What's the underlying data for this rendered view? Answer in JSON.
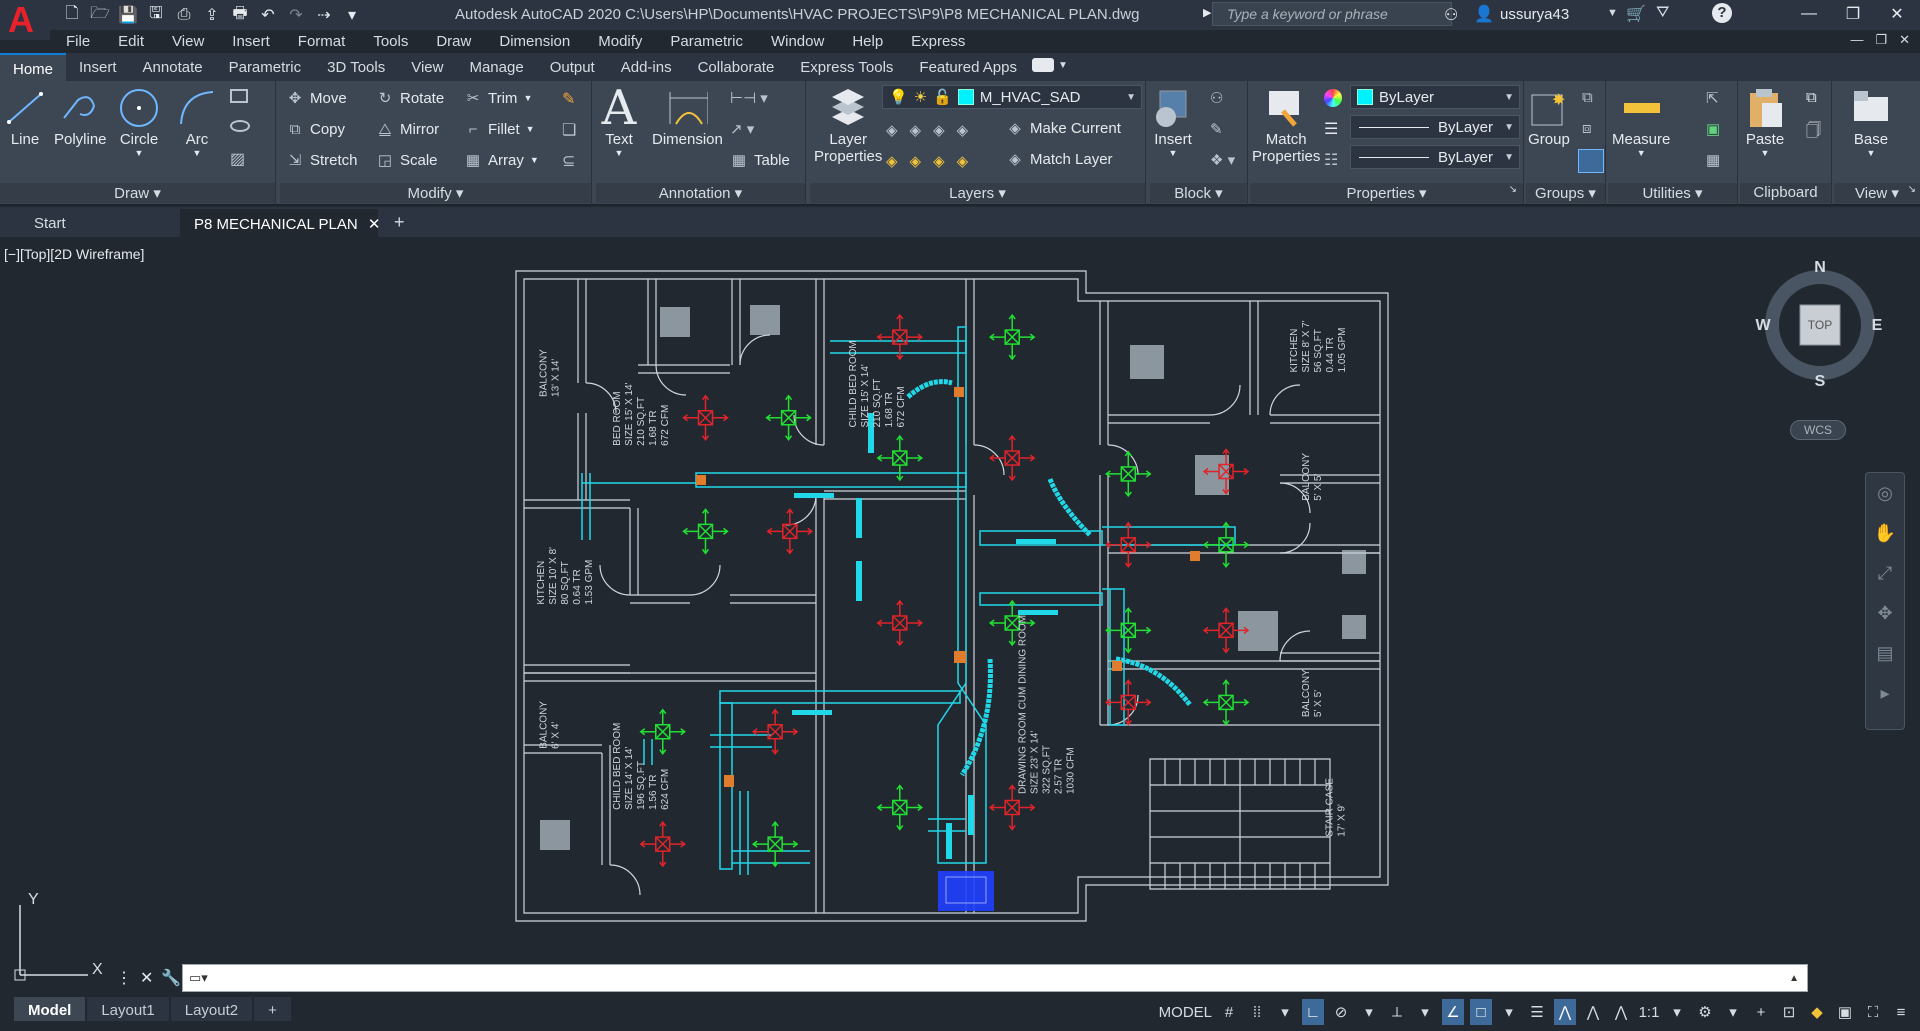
{
  "app": {
    "logo_letter": "A",
    "title": "Autodesk AutoCAD 2020    C:\\Users\\HP\\Documents\\HVAC PROJECTS\\P9\\P8 MECHANICAL PLAN.dwg",
    "search_placeholder": "Type a keyword or phrase",
    "username": "ussurya43"
  },
  "menu": [
    "File",
    "Edit",
    "View",
    "Insert",
    "Format",
    "Tools",
    "Draw",
    "Dimension",
    "Modify",
    "Parametric",
    "Window",
    "Help",
    "Express"
  ],
  "ribbon_tabs": [
    "Home",
    "Insert",
    "Annotate",
    "Parametric",
    "3D Tools",
    "View",
    "Manage",
    "Output",
    "Add-ins",
    "Collaborate",
    "Express Tools",
    "Featured Apps"
  ],
  "ribbon": {
    "draw": {
      "title": "Draw",
      "line": "Line",
      "polyline": "Polyline",
      "circle": "Circle",
      "arc": "Arc"
    },
    "modify": {
      "title": "Modify",
      "move": "Move",
      "rotate": "Rotate",
      "trim": "Trim",
      "copy": "Copy",
      "mirror": "Mirror",
      "fillet": "Fillet",
      "stretch": "Stretch",
      "scale": "Scale",
      "array": "Array"
    },
    "annotation": {
      "title": "Annotation",
      "text": "Text",
      "dimension": "Dimension",
      "table": "Table"
    },
    "layers": {
      "title": "Layers",
      "layer_properties_1": "Layer",
      "layer_properties_2": "Properties",
      "current_layer": "M_HVAC_SAD",
      "make_current": "Make Current",
      "match_layer": "Match Layer"
    },
    "block": {
      "title": "Block",
      "insert": "Insert"
    },
    "properties": {
      "title": "Properties",
      "match_1": "Match",
      "match_2": "Properties",
      "color": "ByLayer",
      "linetype": "ByLayer",
      "lineweight": "ByLayer"
    },
    "groups": {
      "title": "Groups",
      "group": "Group"
    },
    "utilities": {
      "title": "Utilities",
      "measure": "Measure"
    },
    "clipboard": {
      "title": "Clipboard",
      "paste": "Paste"
    },
    "view": {
      "title": "View",
      "base": "Base"
    }
  },
  "doc_tabs": {
    "start": "Start",
    "current": "P8 MECHANICAL PLAN"
  },
  "viewport_label": "[−][Top][2D Wireframe]",
  "viewcube": {
    "n": "N",
    "s": "S",
    "e": "E",
    "w": "W",
    "face": "TOP",
    "wcs": "WCS"
  },
  "ucs": {
    "x": "X",
    "y": "Y"
  },
  "rooms": {
    "balcony_tl": [
      "BALCONY",
      "13' X 14'"
    ],
    "bed_room": [
      "BED ROOM",
      "SIZE 15' X 14'",
      "210 SQ.FT",
      "1.68 TR",
      "672 CFM"
    ],
    "child_bed_top": [
      "CHILD BED ROOM",
      "SIZE 15' X 14'",
      "210 SQ.FT",
      "1.68 TR",
      "672 CFM"
    ],
    "kitchen_l": [
      "KITCHEN",
      "SIZE 10' X 8'",
      "80 SQ.FT",
      "0.64 TR",
      "1.53 GPM"
    ],
    "kitchen_r": [
      "KITCHEN",
      "SIZE 8' X 7'",
      "56 SQ.FT",
      "0.44 TR",
      "1.05 GPM"
    ],
    "balcony_bl": [
      "BALCONY",
      "6' X 4'"
    ],
    "child_bed_bottom": [
      "CHILD BED ROOM",
      "SIZE 14' X 14'",
      "196 SQ.FT",
      "1.56 TR",
      "624 CFM"
    ],
    "drawing_room": [
      "DRAWING ROOM CUM DINING ROOM",
      "SIZE 23' X 14'",
      "322 SQ.FT",
      "2.57 TR",
      "1030 CFM"
    ],
    "balcony_r1": [
      "BALCONY",
      "5' X 5'"
    ],
    "balcony_r2": [
      "BALCONY",
      "5' X 5'"
    ],
    "stair": [
      "STAIR CASE",
      "17' X 9'"
    ]
  },
  "status": {
    "layouts": [
      "Model",
      "Layout1",
      "Layout2"
    ],
    "model": "MODEL",
    "scale": "1:1"
  },
  "colors": {
    "bg": "#212830",
    "ribbon": "#3d4754",
    "duct": "#20d8e8",
    "supply": "#22e033",
    "return": "#e0242a",
    "wall": "#cfd6dd"
  }
}
